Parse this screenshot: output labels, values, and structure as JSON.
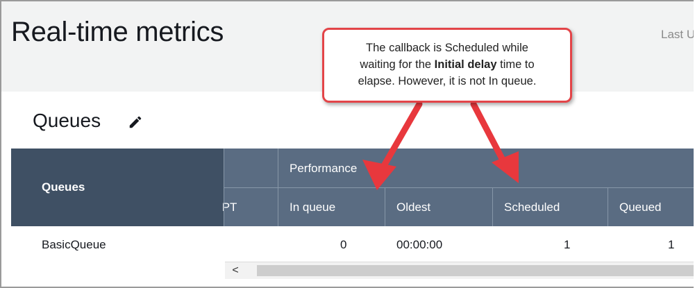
{
  "page": {
    "title": "Real-time metrics",
    "last_updated_label": "Last U"
  },
  "section": {
    "title": "Queues",
    "edit_icon": "pencil-icon"
  },
  "table": {
    "header_group": "Performance",
    "columns": {
      "queues": "Queues",
      "ipt": "IPT",
      "in_queue": "In queue",
      "oldest": "Oldest",
      "scheduled": "Scheduled",
      "queued": "Queued"
    },
    "rows": [
      {
        "queue": "BasicQueue",
        "in_queue": "0",
        "oldest": "00:00:00",
        "scheduled": "1",
        "queued": "1"
      }
    ],
    "scroll_left_glyph": "<"
  },
  "callout": {
    "line1": "The callback is Scheduled while",
    "line2_pre": "waiting for the ",
    "line2_bold": "Initial delay",
    "line2_post": " time to",
    "line3": "elapse. However, it is not In queue."
  },
  "colors": {
    "header_dark": "#3f5064",
    "header_mid": "#5a6c82",
    "callout_border": "#e34448",
    "arrow": "#e8383d"
  }
}
